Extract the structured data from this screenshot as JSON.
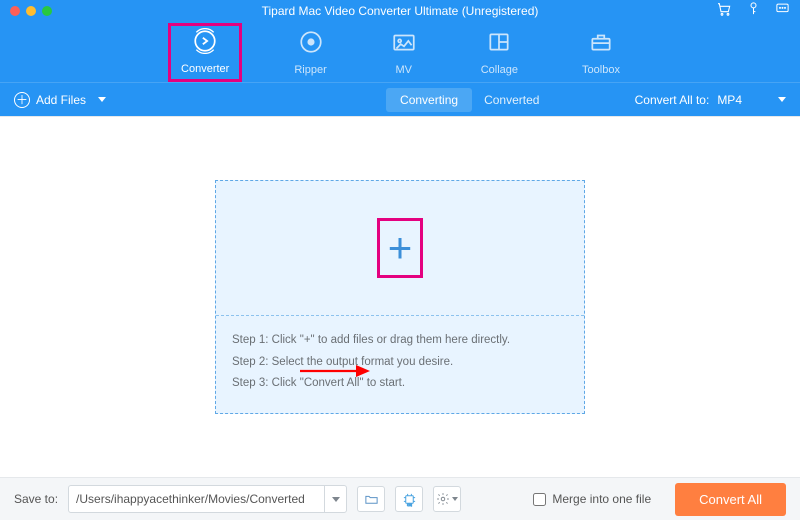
{
  "titlebar": {
    "title": "Tipard Mac Video Converter Ultimate (Unregistered)"
  },
  "nav": {
    "converter": "Converter",
    "ripper": "Ripper",
    "mv": "MV",
    "collage": "Collage",
    "toolbox": "Toolbox"
  },
  "subbar": {
    "add_files": "Add Files",
    "converting": "Converting",
    "converted": "Converted",
    "convert_all_to": "Convert All to:",
    "format": "MP4"
  },
  "drop": {
    "step1": "Step 1: Click \"+\" to add files or drag them here directly.",
    "step2": "Step 2: Select the output format you desire.",
    "step3": "Step 3: Click \"Convert All\" to start."
  },
  "bottom": {
    "save_to": "Save to:",
    "path": "/Users/ihappyacethinker/Movies/Converted",
    "merge": "Merge into one file",
    "convert_all": "Convert All"
  }
}
